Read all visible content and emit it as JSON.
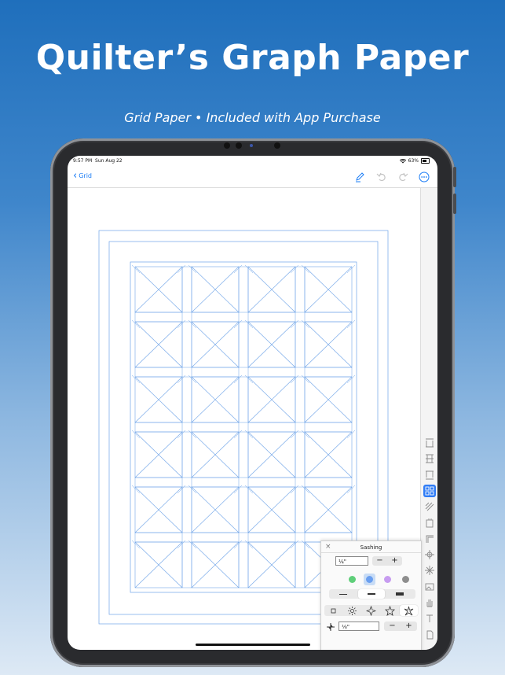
{
  "hero": {
    "title": "Quilter’s Graph Paper",
    "subtitle": "Grid Paper • Included with App Purchase"
  },
  "status_bar": {
    "time": "9:57 PM",
    "date": "Sun Aug 22",
    "battery": "63%"
  },
  "nav": {
    "back_label": "Grid",
    "actions": [
      "pencil-icon",
      "undo-icon",
      "redo-icon",
      "more-icon"
    ]
  },
  "canvas": {
    "grid_color": "#6fa4e8",
    "block_columns": 4,
    "block_rows": 6
  },
  "toolbar": {
    "tools": [
      "border-top-icon",
      "border-middle-icon",
      "border-bottom-icon",
      "sashing-icon",
      "diagonal-lines-icon",
      "sticker-icon",
      "corner-icon",
      "crosshair-icon",
      "compass-star-icon",
      "image-icon",
      "pan-hand-icon",
      "text-icon",
      "document-icon"
    ],
    "active_index": 3,
    "active_color": "#2f7cf6"
  },
  "sashing_panel": {
    "title": "Sashing",
    "close_label": "×",
    "width_value": "¼\"",
    "minus_label": "−",
    "plus_label": "+",
    "colors": [
      "#5fcf7a",
      "#6a9ff0",
      "#c79cf0",
      "#8e8e8e"
    ],
    "selected_color_index": 1,
    "line_weights": [
      "thin",
      "medium",
      "thick"
    ],
    "selected_line_weight_index": 1,
    "star_shapes": [
      "square-icon",
      "sun-icon",
      "four-point-star-icon",
      "star-icon",
      "pinwheel-star-icon"
    ],
    "selected_star_index": 4,
    "cornerstone_value": "⅛\""
  }
}
